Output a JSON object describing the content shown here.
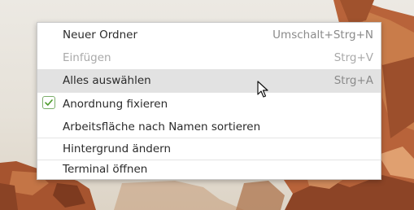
{
  "menu": {
    "items": [
      {
        "label": "Neuer Ordner",
        "accel": "Umschalt+Strg+N",
        "enabled": true
      },
      {
        "label": "Einfügen",
        "accel": "Strg+V",
        "enabled": false
      },
      {
        "label": "Alles auswählen",
        "accel": "Strg+A",
        "enabled": true,
        "highlighted": true
      },
      {
        "label": "Anordnung fixieren",
        "accel": "",
        "enabled": true,
        "checked": true
      },
      {
        "label": "Arbeitsfläche nach Namen sortieren",
        "accel": "",
        "enabled": true
      },
      {
        "label": "Hintergrund ändern",
        "accel": "",
        "enabled": true
      },
      {
        "label": "Terminal öffnen",
        "accel": "",
        "enabled": true
      }
    ]
  },
  "colors": {
    "highlight": "#e2e2e2",
    "check_border": "#7cae6b",
    "check_mark": "#4c9a2a",
    "disabled_text": "#a9a9a9"
  },
  "icons": {
    "check": "checkmark-icon",
    "cursor": "mouse-pointer-icon"
  }
}
